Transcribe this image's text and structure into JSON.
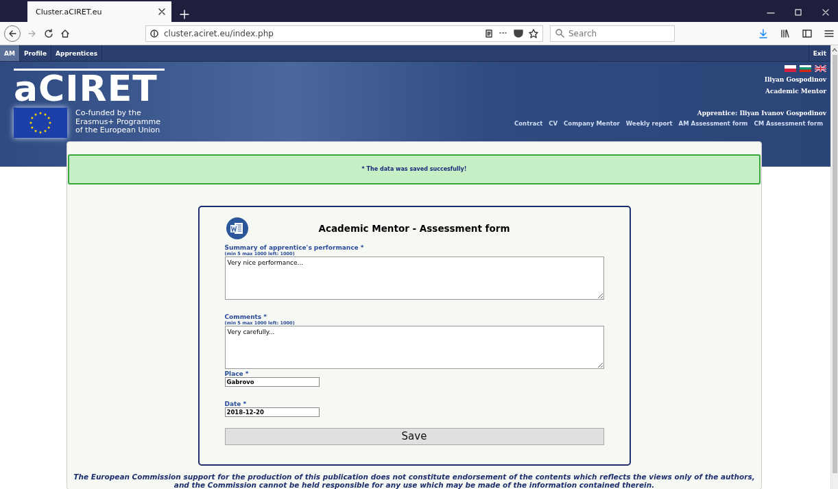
{
  "browser": {
    "tab_title": "Cluster.aCIRET.eu",
    "url": "cluster.aciret.eu/index.php",
    "search": {
      "placeholder": "Search"
    }
  },
  "nav": {
    "items": [
      {
        "label": "AM",
        "selected": true
      },
      {
        "label": "Profile",
        "selected": false
      },
      {
        "label": "Apprentices",
        "selected": false
      }
    ],
    "exit": "Exit"
  },
  "header": {
    "logo": "aCIRET",
    "funding_lines": [
      "Co-funded by the",
      "Erasmus+ Programme",
      "of the European Union"
    ],
    "user_name": "Iliyan Gospodinov",
    "role": "Academic Mentor",
    "apprentice": "Apprentice: Iliyan Ivanov Gospodinov",
    "links": [
      "Contract",
      "CV",
      "Company Mentor",
      "Weekly report",
      "AM Assessment form",
      "CM Assessment form"
    ]
  },
  "message": "* The data was saved succesfully!",
  "form": {
    "title": "Academic Mentor - Assessment form",
    "fields": [
      {
        "kind": "textarea",
        "label": "Summary of apprentice's performance *",
        "hint": "(min 5 max 1000 left: 1000)",
        "value": "Very nice performance..."
      },
      {
        "kind": "textarea",
        "label": "Comments *",
        "hint": "(min 5 max 1000 left: 1000)",
        "value": "Very carefully..."
      },
      {
        "kind": "input",
        "label": "Place *",
        "value": "Gabrovo"
      },
      {
        "kind": "input",
        "label": "Date *",
        "value": "2018-12-20"
      }
    ],
    "save_button": "Save"
  },
  "footer": "The European Commission support for the production of this publication does not constitute endorsement of the contents which reflects the views only of the authors, and the Commission cannot be held responsible for any use which may be made of the information contained therein."
}
